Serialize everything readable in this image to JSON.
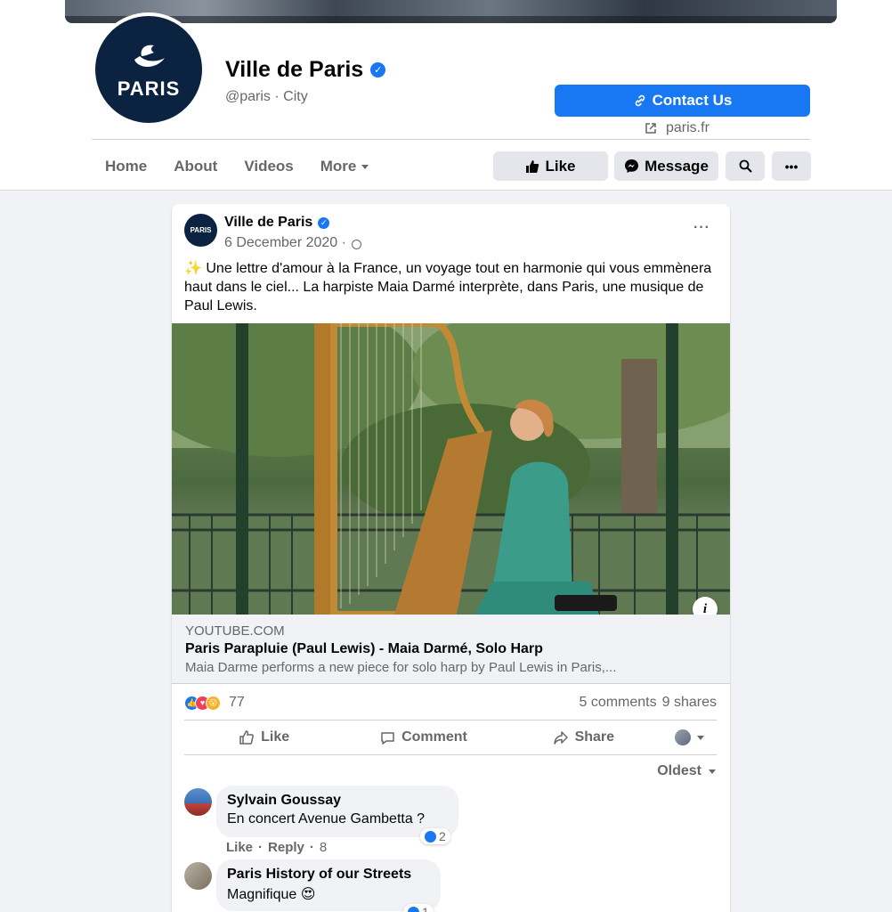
{
  "page": {
    "name": "Ville de Paris",
    "handle": "@paris · City",
    "logo_text": "PARIS",
    "contact_label": "Contact Us",
    "website": "paris.fr"
  },
  "nav": {
    "tabs": [
      {
        "label": "Home"
      },
      {
        "label": "About"
      },
      {
        "label": "Videos"
      },
      {
        "label": "More"
      }
    ],
    "like_label": "Like",
    "message_label": "Message"
  },
  "post": {
    "author": "Ville de Paris",
    "date": "6 December 2020 ·",
    "text": "✨ Une lettre d'amour à la France, un voyage tout en harmonie qui vous emmènera haut dans le ciel... La harpiste Maia Darmé interprète, dans Paris, une musique de Paul Lewis.",
    "link": {
      "domain": "YOUTUBE.COM",
      "title": "Paris Parapluie (Paul Lewis) - Maia Darmé, Solo Harp",
      "description": "Maia Darme performs a new piece for solo harp by Paul Lewis in Paris,..."
    },
    "reaction_count": "77",
    "comments_count": "5 comments",
    "shares_count": "9 shares",
    "actions": {
      "like": "Like",
      "comment": "Comment",
      "share": "Share"
    },
    "sort_label": "Oldest"
  },
  "comments": [
    {
      "name": "Sylvain Goussay",
      "text": "En concert Avenue Gambetta ?",
      "likes": "2",
      "like": "Like",
      "reply": "Reply",
      "time": "8 w"
    },
    {
      "name": "Paris History of our Streets",
      "text": "Magnifique 😍",
      "likes": "1"
    }
  ],
  "colors": {
    "brand": "#1877f2",
    "navy": "#0b2341"
  }
}
